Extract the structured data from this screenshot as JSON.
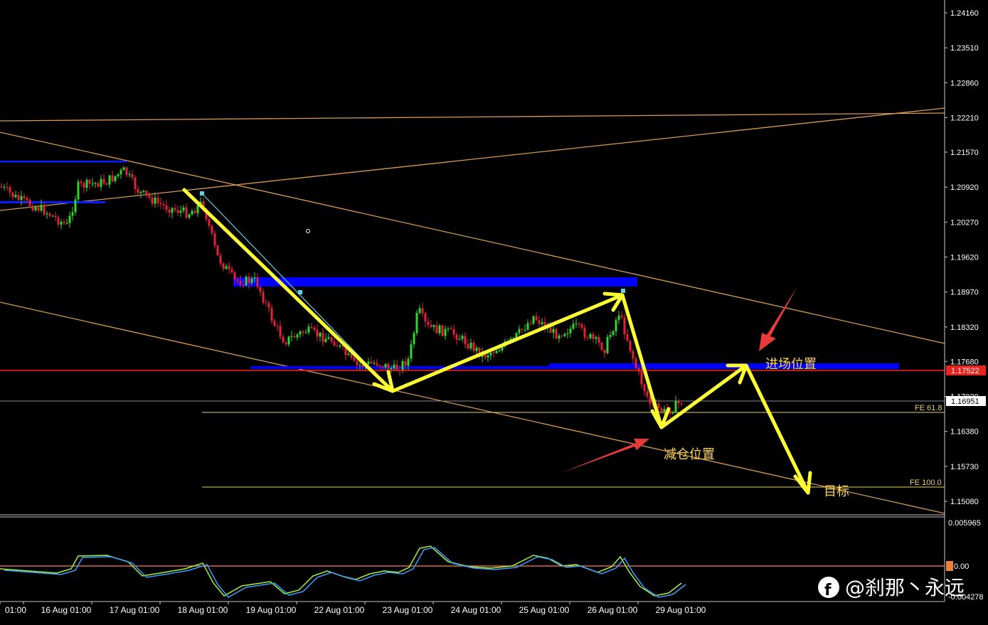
{
  "chart_data": {
    "type": "candlestick",
    "price_axis": {
      "ticks": [
        "1.24160",
        "1.23510",
        "1.22860",
        "1.22210",
        "1.21570",
        "1.20920",
        "1.20270",
        "1.19620",
        "1.18970",
        "1.18320",
        "1.17680",
        "1.17030",
        "1.16380",
        "1.15730",
        "1.15080"
      ],
      "ylim": [
        1.1487,
        1.2436
      ],
      "current_price_label": "1.17522",
      "current_price": 1.17522,
      "bid_label": "1.16951",
      "bid_price": 1.16951
    },
    "time_axis": {
      "ticks": [
        "01:00",
        "16 Aug 01:00",
        "17 Aug 01:00",
        "18 Aug 01:00",
        "19 Aug 01:00",
        "22 Aug 01:00",
        "23 Aug 01:00",
        "24 Aug 01:00",
        "25 Aug 01:00",
        "26 Aug 01:00",
        "29 Aug 01:00"
      ]
    },
    "oscillator": {
      "ticks": [
        "0.005965",
        "0.00",
        "-0.004278"
      ],
      "ylim": [
        -0.00475,
        0.0066
      ],
      "zero_level": 0.0
    },
    "fibonacci": [
      {
        "label": "FE 61.8",
        "price": 1.168
      },
      {
        "label": "FE 100.0",
        "price": 1.1524
      }
    ],
    "annotations": {
      "entry": "进场位置",
      "reduce": "减仓位置",
      "target": "目标"
    },
    "candles": [],
    "watermark": "@刹那丶永远"
  },
  "colors": {
    "background": "#000000",
    "bull": "#32d62f",
    "bear": "#e0223b",
    "trendline": "#d69a52",
    "zone": "#0000ff",
    "path_arrow": "#ffff33",
    "red_arrow": "#e83a3a",
    "price_line": "#ff1e1e",
    "fib_line": "#e8d26a",
    "osc_main": "#3aa0ff",
    "osc_signal": "#a8f040",
    "osc_level": "#ff7f50"
  }
}
